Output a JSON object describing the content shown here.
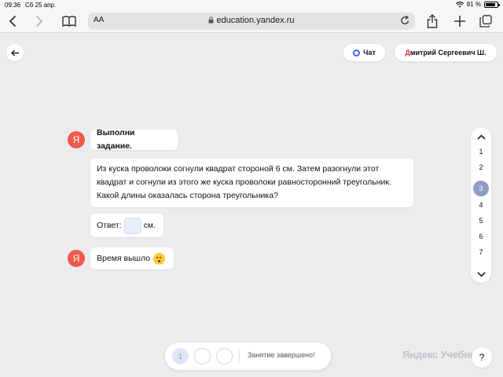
{
  "status_bar": {
    "time": "09:36",
    "date": "Сб 25 апр.",
    "battery": "81 %"
  },
  "browser": {
    "text_size_label": "AA",
    "url": "education.yandex.ru"
  },
  "header": {
    "chat_label": "Чат",
    "user_first_letter": "Д",
    "user_rest": "митрий Сергеевич Ш."
  },
  "messages": {
    "avatar_letter": "Я",
    "instruction": "Выполни задание.",
    "task_text": "Из куска проволоки согнули квадрат стороной 6 см. Затем разогнули этот квадрат и согнули из этого же куска проволоки равносторонний треугольник. Какой длины оказалась сторона треугольника?",
    "answer_label": "Ответ:",
    "answer_unit": "см.",
    "answer_value": "",
    "time_up": "Время вышло"
  },
  "task_nav": {
    "items": [
      "1",
      "2",
      "3",
      "4",
      "5",
      "6",
      "7"
    ],
    "active": "3"
  },
  "bottom_bar": {
    "steps": [
      "1",
      "",
      ""
    ],
    "status": "Занятие завершено!"
  },
  "watermark": "Яндекс Учебник",
  "help_label": "?",
  "colors": {
    "accent": "#3f68f5",
    "avatar": "#f05a4e",
    "active_nav": "#8f9cc4",
    "brand_red": "#e8303a"
  }
}
